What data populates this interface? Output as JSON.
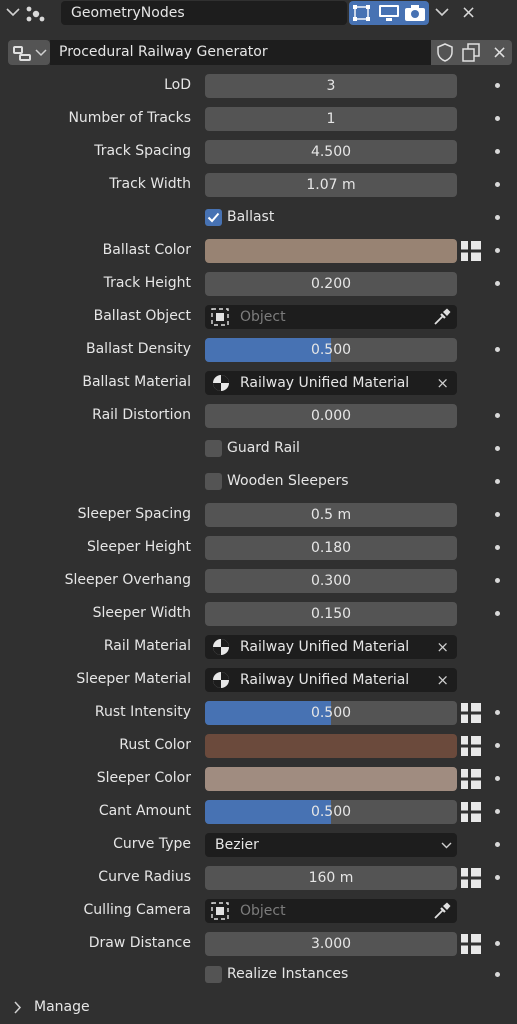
{
  "header": {
    "modifier_name": "GeometryNodes",
    "node_group": "Procedural Railway Generator",
    "collapse_icon": "chevron-down-icon",
    "close_symbol": "×"
  },
  "colors": {
    "accent": "#4772b3",
    "field": "#545454",
    "dark_field": "#1d1d1d",
    "panel": "#303030",
    "ballast_color": "#988373",
    "rust_color": "#6b4a3c",
    "sleeper_color": "#a08c80"
  },
  "properties": {
    "lod": {
      "label": "LoD",
      "value": "3"
    },
    "num_tracks": {
      "label": "Number of Tracks",
      "value": "1"
    },
    "track_spacing": {
      "label": "Track Spacing",
      "value": "4.500"
    },
    "track_width": {
      "label": "Track Width",
      "value": "1.07 m"
    },
    "ballast": {
      "label": "Ballast",
      "checked": true
    },
    "ballast_color": {
      "label": "Ballast Color"
    },
    "track_height": {
      "label": "Track Height",
      "value": "0.200"
    },
    "ballast_object": {
      "label": "Ballast Object",
      "placeholder": "Object"
    },
    "ballast_density": {
      "label": "Ballast Density",
      "value": "0.500",
      "fraction": 0.5
    },
    "ballast_material": {
      "label": "Ballast Material",
      "value": "Railway Unified Material"
    },
    "rail_distortion": {
      "label": "Rail Distortion",
      "value": "0.000"
    },
    "guard_rail": {
      "label": "Guard Rail",
      "checked": false
    },
    "wooden_sleepers": {
      "label": "Wooden Sleepers",
      "checked": false
    },
    "sleeper_spacing": {
      "label": "Sleeper Spacing",
      "value": "0.5 m"
    },
    "sleeper_height": {
      "label": "Sleeper Height",
      "value": "0.180"
    },
    "sleeper_overhang": {
      "label": "Sleeper Overhang",
      "value": "0.300"
    },
    "sleeper_width": {
      "label": "Sleeper Width",
      "value": "0.150"
    },
    "rail_material": {
      "label": "Rail Material",
      "value": "Railway Unified Material"
    },
    "sleeper_material": {
      "label": "Sleeper Material",
      "value": "Railway Unified Material"
    },
    "rust_intensity": {
      "label": "Rust Intensity",
      "value": "0.500",
      "fraction": 0.5
    },
    "rust_color": {
      "label": "Rust Color"
    },
    "sleeper_color": {
      "label": "Sleeper Color"
    },
    "cant_amount": {
      "label": "Cant Amount",
      "value": "0.500",
      "fraction": 0.5
    },
    "curve_type": {
      "label": "Curve Type",
      "value": "Bezier"
    },
    "curve_radius": {
      "label": "Curve Radius",
      "value": "160 m"
    },
    "culling_camera": {
      "label": "Culling Camera",
      "placeholder": "Object"
    },
    "draw_distance": {
      "label": "Draw Distance",
      "value": "3.000"
    },
    "realize_instances": {
      "label": "Realize Instances",
      "checked": false
    }
  },
  "footer": {
    "manage_label": "Manage"
  }
}
